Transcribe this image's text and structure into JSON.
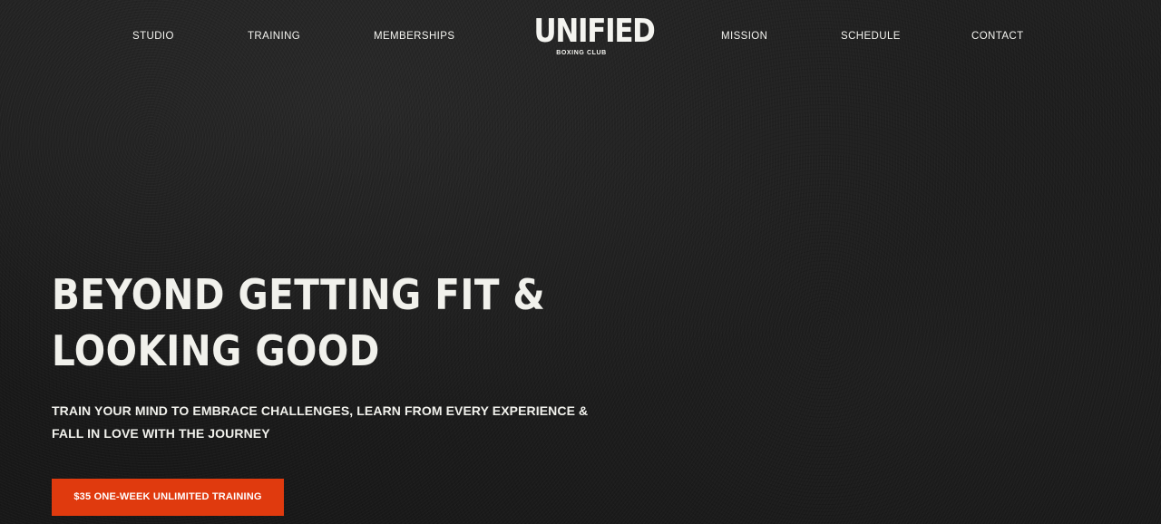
{
  "nav": {
    "left": [
      {
        "label": "STUDIO"
      },
      {
        "label": "TRAINING"
      },
      {
        "label": "MEMBERSHIPS"
      }
    ],
    "right": [
      {
        "label": "MISSION"
      },
      {
        "label": "SCHEDULE"
      },
      {
        "label": "CONTACT"
      }
    ]
  },
  "logo": {
    "main": "UNIFIED",
    "sub": "BOXING CLUB"
  },
  "hero": {
    "heading_lines": [
      "BEYOND GETTING FIT &",
      "LOOKING GOOD"
    ],
    "subheading_lines": [
      "TRAIN YOUR MIND TO EMBRACE CHALLENGES, LEARN FROM EVERY EXPERIENCE &",
      "FALL IN LOVE WITH THE JOURNEY"
    ],
    "cta_label": "$35 ONE-WEEK UNLIMITED TRAINING"
  },
  "colors": {
    "background": "#1b1b1b",
    "text": "#f1f1ec",
    "accent": "#e03a0e"
  }
}
